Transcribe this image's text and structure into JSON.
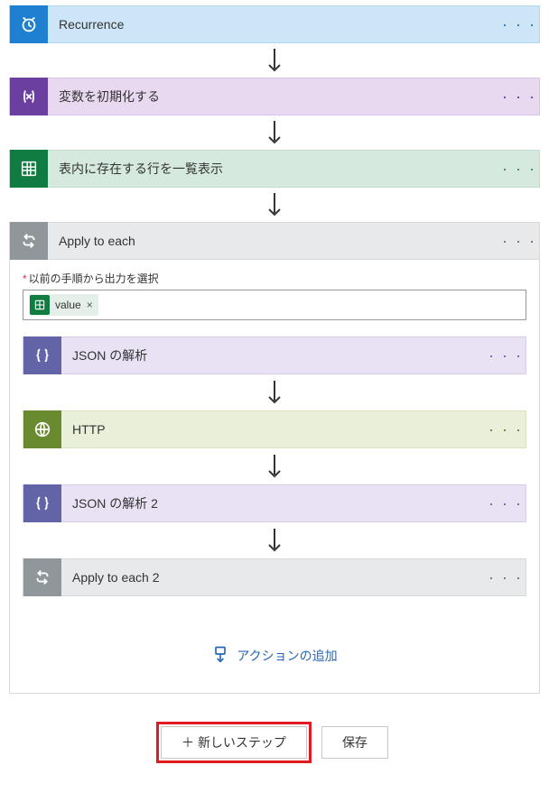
{
  "steps": {
    "recurrence": {
      "label": "Recurrence"
    },
    "init_var": {
      "label": "変数を初期化する"
    },
    "list_rows": {
      "label": "表内に存在する行を一覧表示"
    },
    "apply_each": {
      "label": "Apply to each"
    },
    "json_parse": {
      "label": "JSON の解析"
    },
    "http": {
      "label": "HTTP"
    },
    "json_parse2": {
      "label": "JSON の解析 2"
    },
    "apply_each2": {
      "label": "Apply to each 2"
    }
  },
  "apply_body": {
    "prev_output_label": "以前の手順から出力を選択",
    "token_label": "value"
  },
  "actions": {
    "add_action": "アクションの追加"
  },
  "footer": {
    "new_step": "新しいステップ",
    "save": "保存"
  },
  "glyphs": {
    "ellipsis": "· · ·",
    "plus": "＋",
    "times": "×"
  }
}
